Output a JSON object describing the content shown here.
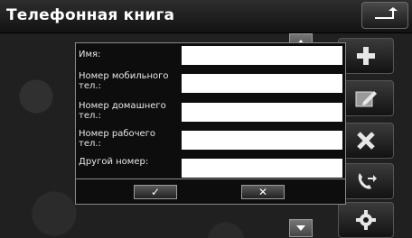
{
  "header": {
    "title": "Телефонная книга",
    "back_icon": "return-arrow-icon"
  },
  "dialog": {
    "fields": [
      {
        "label": "Имя:",
        "value": ""
      },
      {
        "label": "Номер мобильного тел.:",
        "value": ""
      },
      {
        "label": "Номер домашнего тел.:",
        "value": ""
      },
      {
        "label": "Номер рабочего тел.:",
        "value": ""
      },
      {
        "label": "Другой номер:",
        "value": ""
      }
    ],
    "ok_symbol": "✓",
    "cancel_symbol": "✕"
  },
  "side_buttons": [
    "plus-icon",
    "edit-icon",
    "delete-icon",
    "call-forward-icon",
    "settings-icon"
  ],
  "colors": {
    "accent": "#ffffff",
    "background": "#202020"
  }
}
